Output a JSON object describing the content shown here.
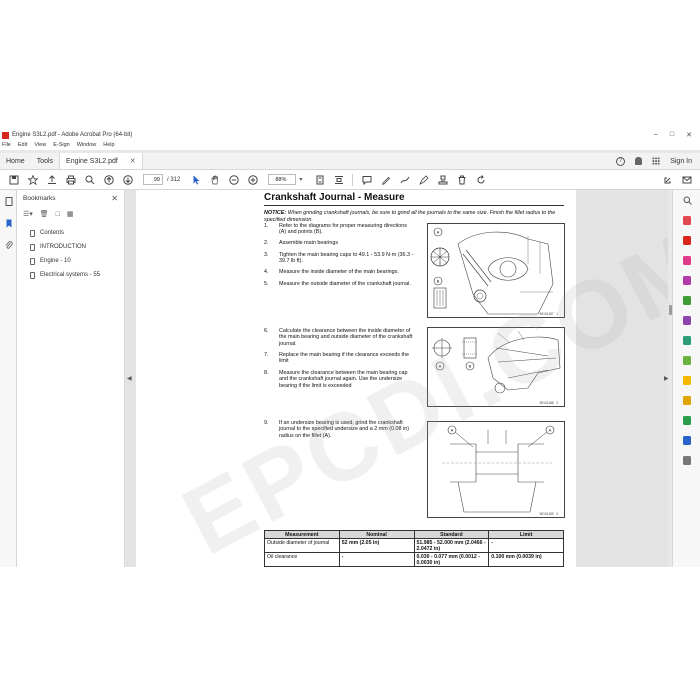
{
  "window": {
    "title": "Engine S3L2.pdf - Adobe Acrobat Pro (64-bit)"
  },
  "menu": [
    "File",
    "Edit",
    "View",
    "E-Sign",
    "Window",
    "Help"
  ],
  "tabs": {
    "home": "Home",
    "tools": "Tools",
    "doc": "Engine S3L2.pdf",
    "sign_in": "Sign In"
  },
  "toolbar": {
    "page_current": "99",
    "page_total": "/ 312",
    "zoom": "88%"
  },
  "bookmarks": {
    "title": "Bookmarks",
    "items": [
      {
        "label": "Contents"
      },
      {
        "label": "INTRODUCTION"
      },
      {
        "label": "Engine - 10"
      },
      {
        "label": "Electrical systems - 55"
      }
    ]
  },
  "document": {
    "heading": "Crankshaft Journal - Measure",
    "notice_label": "NOTICE:",
    "notice_text": "When grinding crankshaft journals, be sure to grind all the journals to the same size. Finish the fillet radius to the specified dimension.",
    "steps": [
      {
        "num": "1.",
        "text": "Refer to the diagrams for proper measuring directions (A) and points (B)."
      },
      {
        "num": "2.",
        "text": "Assemble main bearings"
      },
      {
        "num": "3.",
        "text": "Tighten the main bearing caps to 49.1 - 53.9 N·m (36.3 - 39.7 lb ft)."
      },
      {
        "num": "4.",
        "text": "Measure the inside diameter of the main bearings."
      },
      {
        "num": "5.",
        "text": "Measure the outside diameter of the crankshaft journal."
      },
      {
        "num": "6.",
        "text": "Calculate the clearance between the inside diameter of the main bearing and outside diameter of the crankshaft journal."
      },
      {
        "num": "7.",
        "text": "Replace the main bearing if the clearance exceeds the limit"
      },
      {
        "num": "8.",
        "text": "Measure the clearance between the main bearing cap and the crankshaft journal again. Use the undersize bearing if the limit is exceeded"
      },
      {
        "num": "9.",
        "text": "If an undersize bearing is used, grind the crankshaft journal to the specified undersize and a 2 mm (0.08 in) radius on the fillet (A)."
      }
    ],
    "figures": [
      {
        "code": "50101187",
        "num": "1"
      },
      {
        "code": "50101188",
        "num": "2"
      },
      {
        "code": "50101189",
        "num": "3"
      }
    ],
    "table": {
      "headers": [
        "Measurement",
        "Nominal",
        "Standard",
        "Limit"
      ],
      "rows": [
        [
          "Outside diameter of journal",
          "52 mm (2.05 in)",
          "51.985 - 52.000 mm (2.0466 - 2.0472 in)",
          "-"
        ],
        [
          "Oil clearance",
          "-",
          "0.030 - 0.077 mm (0.0012 - 0.0030 in)",
          "0.100 mm (0.0039 in)"
        ]
      ]
    },
    "watermark": "EPCDI.COM"
  }
}
